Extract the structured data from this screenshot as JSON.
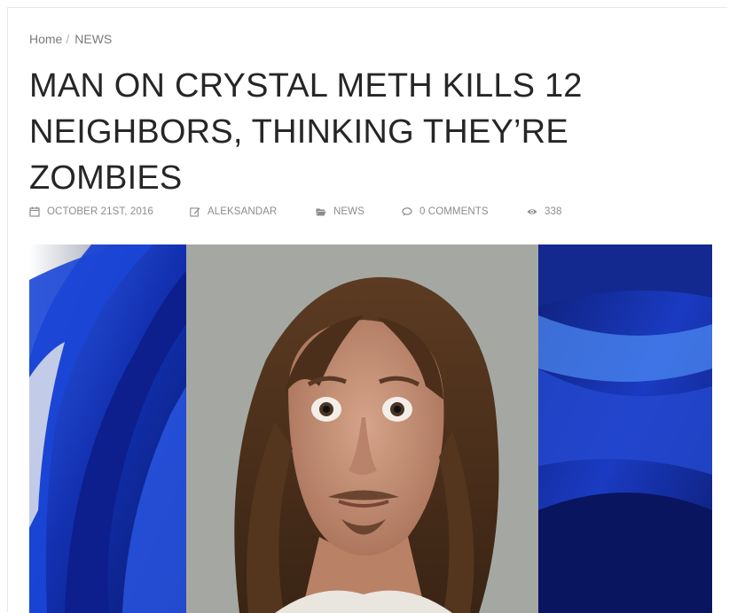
{
  "breadcrumb": {
    "home": "Home",
    "separator": "/",
    "current": "NEWS"
  },
  "article": {
    "title": "MAN ON CRYSTAL METH KILLS 12 NEIGHBORS, THINKING THEY’RE ZOMBIES",
    "meta": {
      "date": "OCTOBER 21ST, 2016",
      "author": "ALEKSANDAR",
      "category": "NEWS",
      "comments": "0 COMMENTS",
      "views": "338"
    }
  },
  "icons": {
    "date": "calendar-icon",
    "author": "edit-icon",
    "category": "folder-icon",
    "comments": "comment-icon",
    "views": "eye-icon"
  },
  "colors": {
    "title": "#262626",
    "meta": "#8c8c8c",
    "breadcrumb": "#7b7b7b",
    "hero_blue": "#1a35b8"
  }
}
